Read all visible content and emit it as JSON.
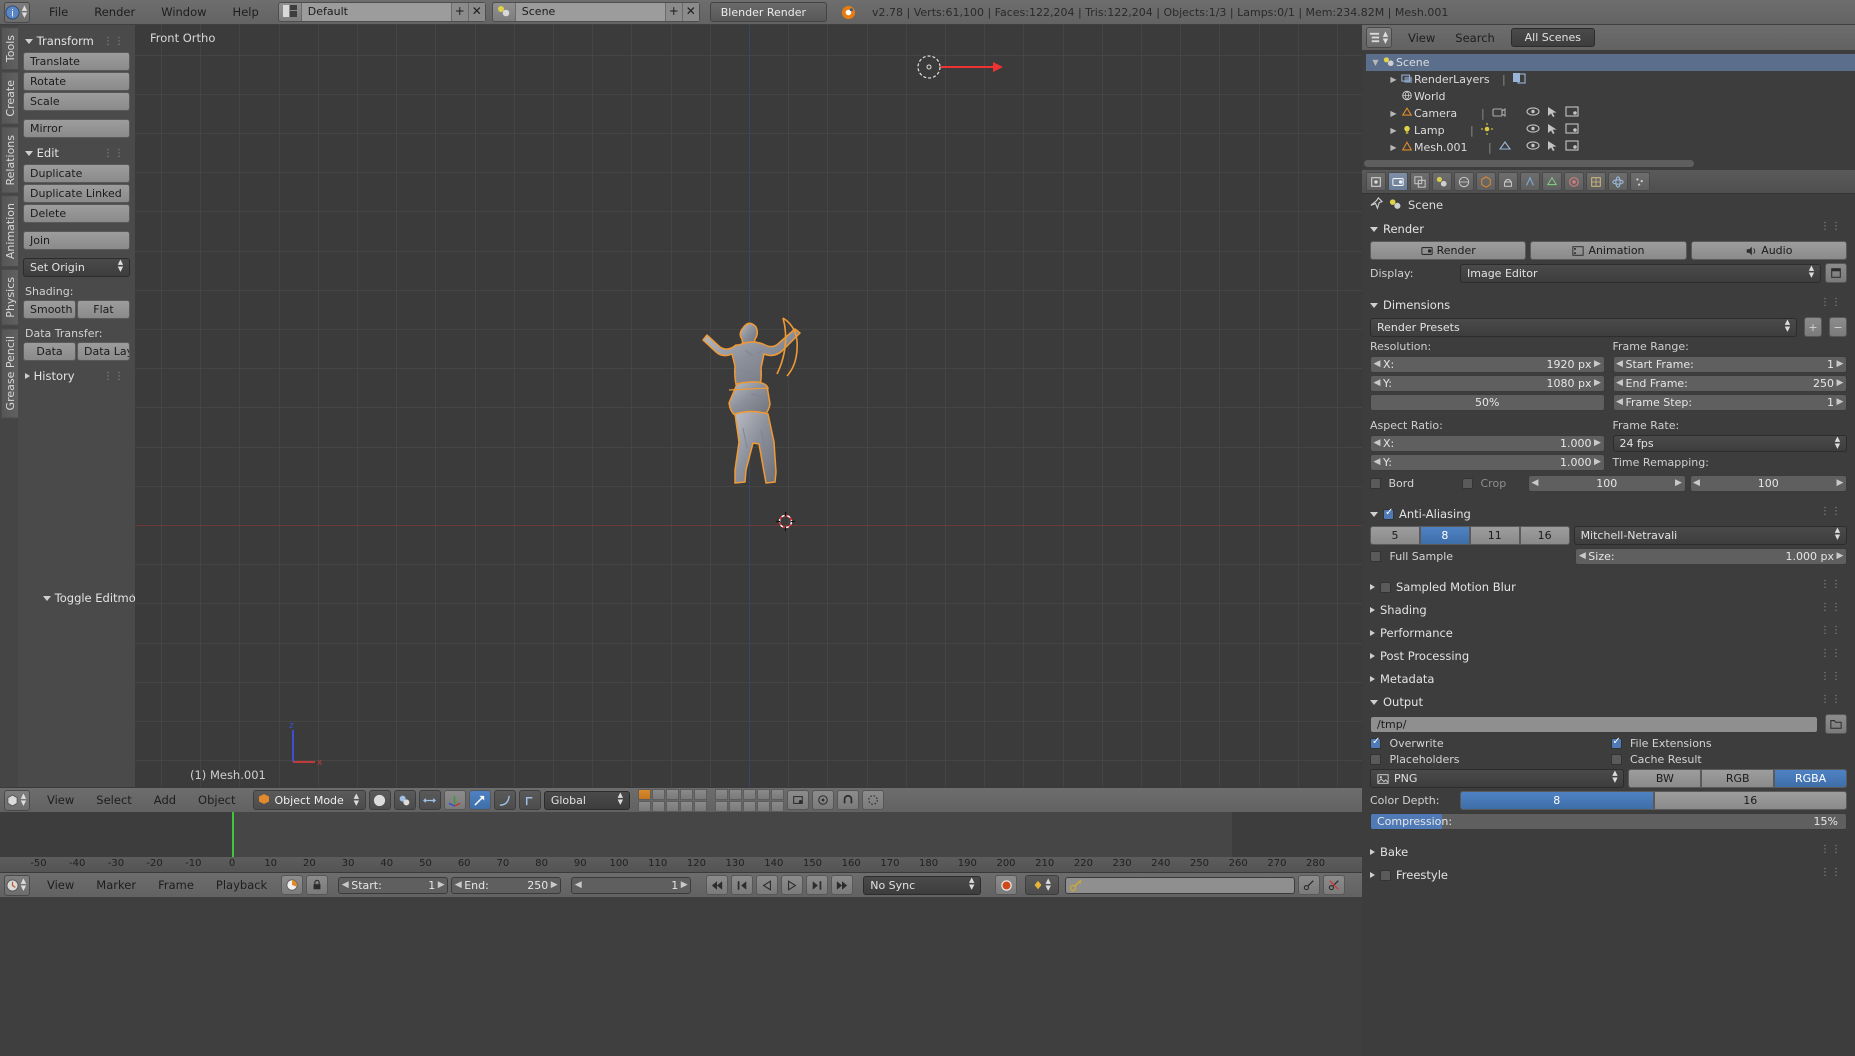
{
  "topbar": {
    "app_icon": "blender-logo-icon",
    "menus": [
      "File",
      "Render",
      "Window",
      "Help"
    ],
    "screen_layout": {
      "icon": "screen-layout-icon",
      "value": "Default",
      "add": "+",
      "remove": "✕"
    },
    "scene_select": {
      "icon": "scene-icon",
      "value": "Scene",
      "add": "+",
      "remove": "✕"
    },
    "engine": "Blender Render",
    "stats": "v2.78 | Verts:61,100 | Faces:122,204 | Tris:122,204 | Objects:1/3 | Lamps:0/1 | Mem:234.82M | Mesh.001"
  },
  "tool_tabs": [
    "Tools",
    "Create",
    "Relations",
    "Animation",
    "Physics",
    "Grease Pencil"
  ],
  "toolshelf": {
    "transform": {
      "title": "Transform",
      "buttons": [
        "Translate",
        "Rotate",
        "Scale"
      ],
      "mirror": "Mirror"
    },
    "edit": {
      "title": "Edit",
      "buttons": [
        "Duplicate",
        "Duplicate Linked",
        "Delete"
      ],
      "join": "Join",
      "set_origin": "Set Origin",
      "shading_label": "Shading:",
      "shading": [
        "Smooth",
        "Flat"
      ],
      "data_transfer_label": "Data Transfer:",
      "data_transfer": [
        "Data",
        "Data Layo"
      ]
    },
    "history": {
      "title": "History"
    },
    "toggle_editmode": "Toggle Editmode"
  },
  "viewport": {
    "view_label": "Front Ortho",
    "object_label": "(1) Mesh.001",
    "lamp_icon": "lamp-object-icon",
    "cursor_icon": "3d-cursor-icon",
    "gizmo_z": "z",
    "gizmo_x": "x"
  },
  "viewport_header": {
    "editor_icon": "editor-type-icon",
    "menus": [
      "View",
      "Select",
      "Add",
      "Object"
    ],
    "mode": "Object Mode",
    "mode_icon": "object-mode-icon",
    "shading_icon": "viewport-shading-icon",
    "pivot_icon": "pivot-point-icon",
    "manipulator_icons": [
      "translate-manipulator-icon",
      "rotate-manipulator-icon",
      "scale-manipulator-icon"
    ],
    "orientation": "Global",
    "snap_icon": "snap-magnet-icon",
    "proportional_icon": "proportional-edit-icon",
    "render_icons": [
      "render-ob-icon",
      "render-view-icon"
    ]
  },
  "timeline": {
    "editor_icon": "timeline-editor-icon",
    "menus": [
      "View",
      "Marker",
      "Frame",
      "Playback"
    ],
    "use_preview_icon": "preview-range-icon",
    "lock_icon": "lock-icon",
    "start_label": "Start:",
    "start_value": "1",
    "end_label": "End:",
    "end_value": "250",
    "current_frame": "1",
    "transport": [
      "jump-start-icon",
      "prev-keyframe-icon",
      "play-reverse-icon",
      "play-icon",
      "next-keyframe-icon",
      "jump-end-icon"
    ],
    "sync_mode": "No Sync",
    "record_icon": "record-icon",
    "keying_icon": "keyframe-icon",
    "keying_set_placeholder": "",
    "keying_set_icon": "keying-set-icon",
    "add_keyframe_icon": "add-keyframe-icon",
    "remove_keyframe_icon": "remove-keyframe-icon",
    "ruler_ticks": [
      "-50",
      "-40",
      "-30",
      "-20",
      "-10",
      "0",
      "10",
      "20",
      "30",
      "40",
      "50",
      "60",
      "70",
      "80",
      "90",
      "100",
      "110",
      "120",
      "130",
      "140",
      "150",
      "160",
      "170",
      "180",
      "190",
      "200",
      "210",
      "220",
      "230",
      "240",
      "250",
      "260",
      "270",
      "280"
    ]
  },
  "outliner": {
    "editor_icon": "outliner-editor-icon",
    "menus": [
      "View",
      "Search"
    ],
    "display_mode": "All Scenes",
    "items": [
      {
        "label": "Scene",
        "icon": "scene-icon",
        "depth": 0,
        "selected": true,
        "expandable": true
      },
      {
        "label": "RenderLayers",
        "icon": "renderlayers-icon",
        "depth": 1,
        "expandable": true
      },
      {
        "label": "World",
        "icon": "world-icon",
        "depth": 1,
        "expandable": false
      },
      {
        "label": "Camera",
        "icon": "camera-icon",
        "depth": 1,
        "expandable": true
      },
      {
        "label": "Lamp",
        "icon": "lamp-icon",
        "depth": 1,
        "expandable": true
      },
      {
        "label": "Mesh.001",
        "icon": "mesh-icon",
        "depth": 1,
        "expandable": true
      }
    ]
  },
  "properties": {
    "tabs": [
      "render-tab-icon",
      "render-layers-tab-icon",
      "scene-tab-icon",
      "world-tab-icon",
      "object-tab-icon",
      "constraints-tab-icon",
      "modifiers-tab-icon",
      "data-tab-icon",
      "material-tab-icon",
      "texture-tab-icon",
      "physics-tab-icon",
      "particles-tab-icon"
    ],
    "active_tab_index": 0,
    "breadcrumb_icon": "pin-icon",
    "breadcrumb_scene_icon": "scene-icon",
    "breadcrumb": "Scene",
    "render": {
      "title": "Render",
      "render_button": "Render",
      "animation_button": "Animation",
      "audio_button": "Audio",
      "render_icon": "camera-back-icon",
      "animation_icon": "film-icon",
      "audio_icon": "speaker-icon",
      "display_label": "Display:",
      "display_value": "Image Editor",
      "display_extra_icon": "new-window-icon"
    },
    "dimensions": {
      "title": "Dimensions",
      "presets_label": "Render Presets",
      "presets_add": "+",
      "presets_remove": "−",
      "resolution_label": "Resolution:",
      "res_x_label": "X:",
      "res_x_value": "1920 px",
      "res_y_label": "Y:",
      "res_y_value": "1080 px",
      "res_percent": "50%",
      "frame_range_label": "Frame Range:",
      "start_frame_label": "Start Frame:",
      "start_frame_value": "1",
      "end_frame_label": "End Frame:",
      "end_frame_value": "250",
      "frame_step_label": "Frame Step:",
      "frame_step_value": "1",
      "aspect_label": "Aspect Ratio:",
      "aspect_x_label": "X:",
      "aspect_x_value": "1.000",
      "aspect_y_label": "Y:",
      "aspect_y_value": "1.000",
      "frame_rate_label": "Frame Rate:",
      "frame_rate_value": "24 fps",
      "time_remap_label": "Time Remapping:",
      "time_remap_old": "100",
      "time_remap_new": "100",
      "border_label": "Bord",
      "crop_label": "Crop"
    },
    "antialiasing": {
      "title": "Anti-Aliasing",
      "enabled": true,
      "samples": [
        "5",
        "8",
        "11",
        "16"
      ],
      "active_sample": "8",
      "filter": "Mitchell-Netravali",
      "full_sample_label": "Full Sample",
      "size_label": "Size:",
      "size_value": "1.000 px"
    },
    "collapsed_sections": [
      "Sampled Motion Blur",
      "Shading",
      "Performance",
      "Post Processing",
      "Metadata"
    ],
    "output": {
      "title": "Output",
      "path": "/tmp/",
      "folder_icon": "folder-icon",
      "overwrite_label": "Overwrite",
      "overwrite": true,
      "file_extensions_label": "File Extensions",
      "file_extensions": true,
      "placeholders_label": "Placeholders",
      "placeholders": false,
      "cache_result_label": "Cache Result",
      "cache_result": false,
      "format": "PNG",
      "format_icon": "image-icon",
      "channels": [
        "BW",
        "RGB",
        "RGBA"
      ],
      "active_channel": "RGBA",
      "color_depth_label": "Color Depth:",
      "color_depth": [
        "8",
        "16"
      ],
      "active_depth": "8",
      "compression_label": "Compression:",
      "compression_value": "15%",
      "compression_percent": 15
    },
    "bottom_sections": [
      "Bake",
      "Freestyle"
    ]
  },
  "colors": {
    "accent_blue": "#4f7ab5",
    "orange": "#e08a2b",
    "header_gray": "#6d6d6d",
    "panel_gray": "#3d3d3d",
    "viewport_bg": "#3b3b3b",
    "outline_orange": "#f09a36"
  }
}
